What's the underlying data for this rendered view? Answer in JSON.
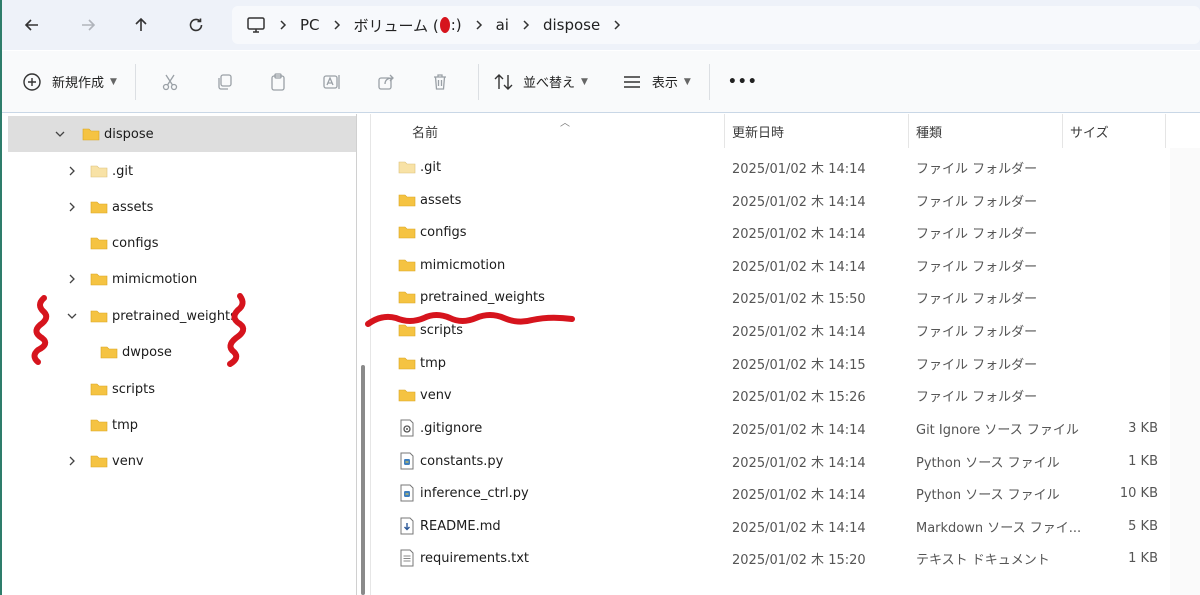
{
  "address": {
    "crumbs": [
      "PC",
      "ボリューム (",
      ":)",
      "ai",
      "dispose"
    ]
  },
  "toolbar": {
    "new_label": "新規作成",
    "sort_label": "並べ替え",
    "view_label": "表示",
    "more_label": "•••"
  },
  "tree": {
    "items": [
      {
        "label": "dispose"
      },
      {
        "label": ".git"
      },
      {
        "label": "assets"
      },
      {
        "label": "configs"
      },
      {
        "label": "mimicmotion"
      },
      {
        "label": "pretrained_weights"
      },
      {
        "label": "dwpose"
      },
      {
        "label": "scripts"
      },
      {
        "label": "tmp"
      },
      {
        "label": "venv"
      }
    ]
  },
  "columns": {
    "name": "名前",
    "date": "更新日時",
    "type": "種類",
    "size": "サイズ"
  },
  "files": [
    {
      "name": ".git",
      "date": "2025/01/02 木 14:14",
      "type": "ファイル フォルダー",
      "size": ""
    },
    {
      "name": "assets",
      "date": "2025/01/02 木 14:14",
      "type": "ファイル フォルダー",
      "size": ""
    },
    {
      "name": "configs",
      "date": "2025/01/02 木 14:14",
      "type": "ファイル フォルダー",
      "size": ""
    },
    {
      "name": "mimicmotion",
      "date": "2025/01/02 木 14:14",
      "type": "ファイル フォルダー",
      "size": ""
    },
    {
      "name": "pretrained_weights",
      "date": "2025/01/02 木 15:50",
      "type": "ファイル フォルダー",
      "size": ""
    },
    {
      "name": "scripts",
      "date": "2025/01/02 木 14:14",
      "type": "ファイル フォルダー",
      "size": ""
    },
    {
      "name": "tmp",
      "date": "2025/01/02 木 14:15",
      "type": "ファイル フォルダー",
      "size": ""
    },
    {
      "name": "venv",
      "date": "2025/01/02 木 15:26",
      "type": "ファイル フォルダー",
      "size": ""
    },
    {
      "name": ".gitignore",
      "date": "2025/01/02 木 14:14",
      "type": "Git Ignore ソース ファイル",
      "size": "3 KB"
    },
    {
      "name": "constants.py",
      "date": "2025/01/02 木 14:14",
      "type": "Python ソース ファイル",
      "size": "1 KB"
    },
    {
      "name": "inference_ctrl.py",
      "date": "2025/01/02 木 14:14",
      "type": "Python ソース ファイル",
      "size": "10 KB"
    },
    {
      "name": "README.md",
      "date": "2025/01/02 木 14:14",
      "type": "Markdown ソース ファイ...",
      "size": "5 KB"
    },
    {
      "name": "requirements.txt",
      "date": "2025/01/02 木 15:20",
      "type": "テキスト ドキュメント",
      "size": "1 KB"
    }
  ],
  "colors": {
    "folder": "#f5c342",
    "marker": "#d6141d",
    "selection": "#dedede"
  }
}
